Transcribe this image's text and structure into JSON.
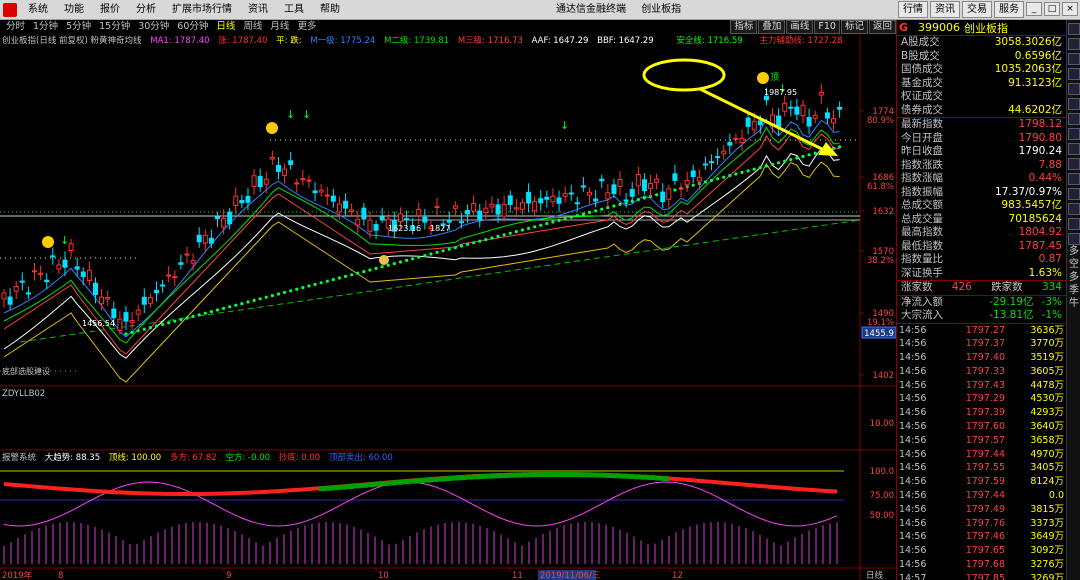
{
  "titlebar": {
    "menus": [
      "系统",
      "功能",
      "报价",
      "分析",
      "扩展市场行情",
      "资讯",
      "工具",
      "帮助"
    ],
    "app_name": "通达信金融终端",
    "index_name": "创业板指",
    "buttons": [
      "行情",
      "资讯",
      "交易",
      "服务"
    ]
  },
  "periodbar": {
    "tabs": [
      "分时",
      "1分钟",
      "5分钟",
      "15分钟",
      "30分钟",
      "60分钟",
      "日线",
      "周线",
      "月线",
      "更多"
    ],
    "active": "日线",
    "tools": [
      "指标",
      "叠加",
      "画线",
      "F10",
      "标记",
      "返回"
    ]
  },
  "legend": {
    "main": {
      "name": "创业板指(日线 前复权) 粉黄神奇均线",
      "items": [
        {
          "label": "MA1: 1787.40",
          "color": "#ff40ff"
        },
        {
          "label": "涨: 1787.40",
          "color": "#ff3030"
        },
        {
          "label": "平: 跌:",
          "color": "#ffff00"
        },
        {
          "label": "M一级: 1775.24",
          "color": "#3080ff"
        },
        {
          "label": "M二级: 1739.81",
          "color": "#00e000"
        },
        {
          "label": "M三级: 1716.73",
          "color": "#ff4040"
        },
        {
          "label": "AAF: 1647.29",
          "color": "#ffffff"
        },
        {
          "label": "BBF: 1647.29",
          "color": "#ffffff"
        },
        {
          "label": "安全线: 1716.59",
          "color": "#00ff00"
        },
        {
          "label": "主力辅助线: 1727.28",
          "color": "#ff3030"
        }
      ]
    },
    "sub": {
      "name": "ZDYLLB02"
    },
    "alarm": {
      "name": "报警系统",
      "items": [
        {
          "label": "大趋势: 88.35",
          "color": "#ffffff"
        },
        {
          "label": "顶线: 100.00",
          "color": "#ffff00"
        },
        {
          "label": "多方: 67.82",
          "color": "#ff3030"
        },
        {
          "label": "空方: -0.00",
          "color": "#00e000"
        },
        {
          "label": "抄底: 0.00",
          "color": "#ff3030"
        },
        {
          "label": "顶部卖出: 60.00",
          "color": "#3060ff"
        }
      ]
    }
  },
  "annotations": {
    "high": "1987.95",
    "low1": "1623.16",
    "low2": "1827",
    "low3": "1456.54",
    "bottom_left": "底部选股建设",
    "price_tag": "1455.9",
    "buy_marker": "顶"
  },
  "yaxis": {
    "main": [
      {
        "v": "1774",
        "p": "80.9%"
      },
      {
        "v": "1686",
        "p": "61.8%"
      },
      {
        "v": "1632",
        "p": ""
      },
      {
        "v": "1570",
        "p": "38.2%"
      },
      {
        "v": "1490",
        "p": "19.1%"
      },
      {
        "v": "1402",
        "p": ""
      }
    ],
    "sub": [
      "10.00"
    ],
    "alarm": [
      "100.0",
      "75.00",
      "50.00"
    ]
  },
  "xaxis": {
    "labels": [
      "2019年",
      "8",
      "9",
      "10",
      "11",
      "2019/11/06/三",
      "12"
    ],
    "corner": "日线"
  },
  "right_panel": {
    "code": "399006",
    "name": "创业板指",
    "g_label": "G",
    "stats_a": [
      {
        "label": "A股成交",
        "value": "3058.3026亿",
        "color": "yellow"
      },
      {
        "label": "B股成交",
        "value": "0.6596亿",
        "color": "yellow"
      },
      {
        "label": "国债成交",
        "value": "1035.2063亿",
        "color": "yellow"
      },
      {
        "label": "基金成交",
        "value": "91.3123亿",
        "color": "yellow"
      },
      {
        "label": "权证成交",
        "value": "",
        "color": "yellow"
      },
      {
        "label": "债券成交",
        "value": "44.6202亿",
        "color": "yellow"
      }
    ],
    "stats_b": [
      {
        "label": "最新指数",
        "value": "1798.12",
        "color": "red"
      },
      {
        "label": "今日开盘",
        "value": "1790.80",
        "color": "red"
      },
      {
        "label": "昨日收盘",
        "value": "1790.24",
        "color": "white"
      },
      {
        "label": "指数涨跌",
        "value": "7.88",
        "color": "red"
      },
      {
        "label": "指数涨幅",
        "value": "0.44%",
        "color": "red"
      },
      {
        "label": "指数振幅",
        "value": "17.37/0.97%",
        "color": "white"
      },
      {
        "label": "总成交额",
        "value": "983.5457亿",
        "color": "yellow"
      },
      {
        "label": "总成交量",
        "value": "70185624",
        "color": "yellow"
      },
      {
        "label": "最高指数",
        "value": "1804.92",
        "color": "red"
      },
      {
        "label": "最低指数",
        "value": "1787.45",
        "color": "red"
      },
      {
        "label": "指数量比",
        "value": "0.87",
        "color": "red"
      },
      {
        "label": "深证换手",
        "value": "1.63%",
        "color": "yellow"
      }
    ],
    "updown": {
      "up_label": "涨家数",
      "up": "426",
      "down_label": "跌家数",
      "down": "334"
    },
    "flows": [
      {
        "label": "净流入额",
        "value": "-29.19亿",
        "pct": "-3%"
      },
      {
        "label": "大宗流入",
        "value": "-13.81亿",
        "pct": "-1%"
      }
    ],
    "ticks": [
      {
        "t": "14:56",
        "p": "1797.27",
        "v": "3636万"
      },
      {
        "t": "14:56",
        "p": "1797.37",
        "v": "3770万"
      },
      {
        "t": "14:56",
        "p": "1797.40",
        "v": "3519万"
      },
      {
        "t": "14:56",
        "p": "1797.33",
        "v": "3605万"
      },
      {
        "t": "14:56",
        "p": "1797.43",
        "v": "4478万"
      },
      {
        "t": "14:56",
        "p": "1797.29",
        "v": "4530万"
      },
      {
        "t": "14:56",
        "p": "1797.39",
        "v": "4293万"
      },
      {
        "t": "14:56",
        "p": "1797.60",
        "v": "3640万"
      },
      {
        "t": "14:56",
        "p": "1797.57",
        "v": "3658万"
      },
      {
        "t": "14:56",
        "p": "1797.44",
        "v": "4970万"
      },
      {
        "t": "14:56",
        "p": "1797.55",
        "v": "3405万"
      },
      {
        "t": "14:56",
        "p": "1797.59",
        "v": "8124万"
      },
      {
        "t": "14:56",
        "p": "1797.44",
        "v": "0.0"
      },
      {
        "t": "14:56",
        "p": "1797.49",
        "v": "3815万"
      },
      {
        "t": "14:56",
        "p": "1797.76",
        "v": "3373万"
      },
      {
        "t": "14:56",
        "p": "1797.46",
        "v": "3649万"
      },
      {
        "t": "14:56",
        "p": "1797.65",
        "v": "3092万"
      },
      {
        "t": "14:56",
        "p": "1797.68",
        "v": "3276万"
      },
      {
        "t": "14:57",
        "p": "1797.85",
        "v": "3269万"
      }
    ]
  },
  "strip": {
    "icons": [
      "grid-icon",
      "chart-icon",
      "table-icon",
      "fe-icon",
      "chart2-icon",
      "table2-icon",
      "dot-icon",
      "bar-icon",
      "line-icon",
      "ma-icon",
      "rsi-icon",
      "bar2-icon",
      "cross-icon",
      "zoom-in-icon",
      "zoom-out-icon"
    ],
    "labels": [
      "多",
      "空",
      "多",
      "季",
      "牛"
    ]
  },
  "colors": {
    "up": "#ff3030",
    "down": "#00e0ff",
    "ma_yellow": "#ffff00",
    "ma_green": "#00e000",
    "ma_blue": "#3080ff",
    "highlight_ellipse": "#ffff00"
  }
}
